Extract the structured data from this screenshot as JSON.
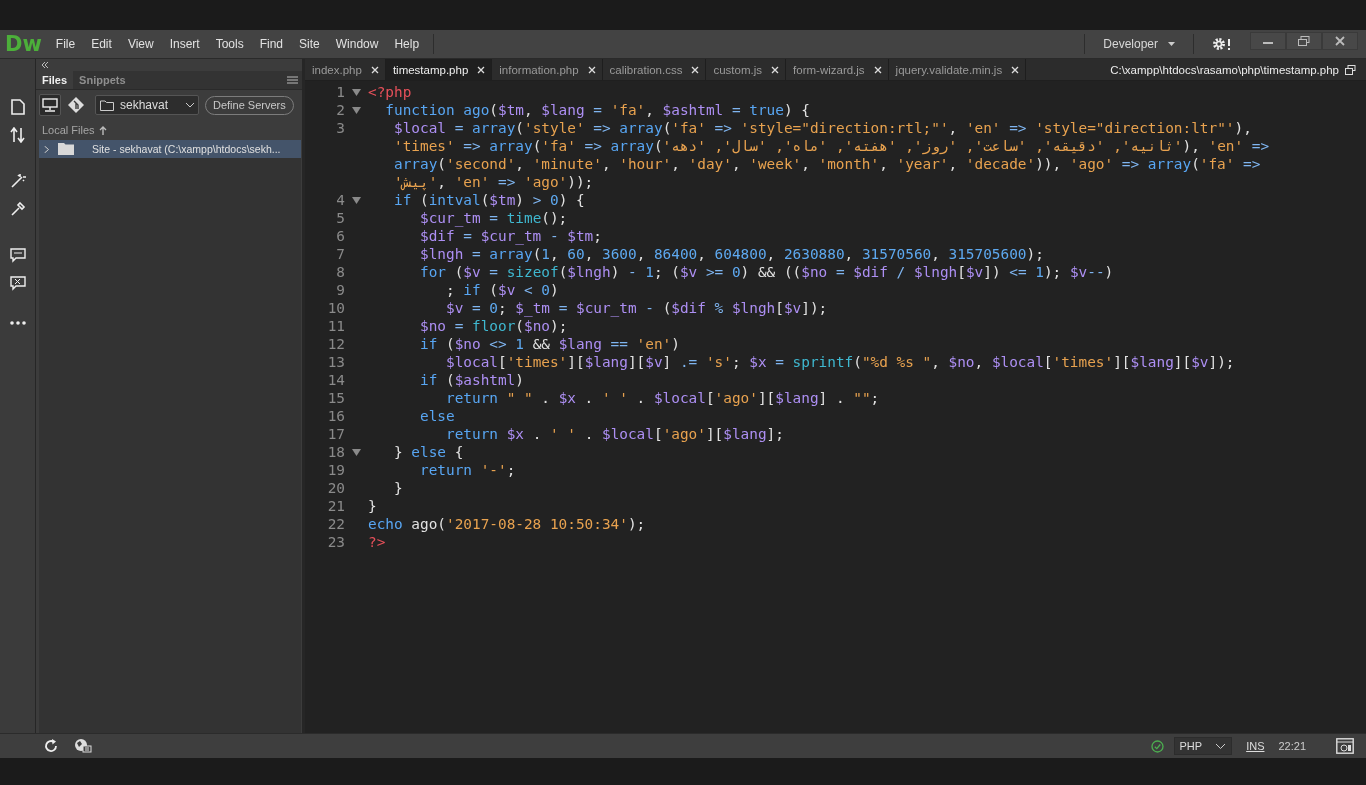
{
  "menu_bar": {
    "logo": "Dw",
    "items": [
      "File",
      "Edit",
      "View",
      "Insert",
      "Tools",
      "Find",
      "Site",
      "Window",
      "Help"
    ],
    "workspace": "Developer"
  },
  "files_panel": {
    "tabs": [
      {
        "label": "Files",
        "selected": true
      },
      {
        "label": "Snippets",
        "selected": false
      }
    ],
    "site": "sekhavat",
    "define_button": "Define Servers",
    "header": "Local Files",
    "tree": [
      {
        "label": "Site - sekhavat (C:\\xampp\\htdocs\\sekh...",
        "selected": true,
        "expanded": false
      }
    ]
  },
  "document_tabs": [
    {
      "label": "index.php",
      "selected": false
    },
    {
      "label": "timestamp.php",
      "selected": true
    },
    {
      "label": "information.php",
      "selected": false
    },
    {
      "label": "calibration.css",
      "selected": false
    },
    {
      "label": "custom.js",
      "selected": false
    },
    {
      "label": "form-wizard.js",
      "selected": false
    },
    {
      "label": "jquery.validate.min.js",
      "selected": false
    }
  ],
  "file_path": "C:\\xampp\\htdocs\\rasamo\\php\\timestamp.php",
  "code": [
    {
      "number": "1",
      "foldable": true,
      "wraps": [
        {
          "tokens": [
            {
              "kind": "tag",
              "text": "<?php"
            }
          ]
        }
      ]
    },
    {
      "number": "2",
      "foldable": true,
      "wraps": [
        {
          "tokens": [
            {
              "kind": "kw",
              "text": "  function"
            },
            {
              "kind": "kw",
              "text": " ago"
            },
            {
              "kind": "text",
              "text": "("
            },
            {
              "kind": "var",
              "text": "$tm"
            },
            {
              "kind": "text",
              "text": ", "
            },
            {
              "kind": "var",
              "text": "$lang"
            },
            {
              "kind": "op",
              "text": " = "
            },
            {
              "kind": "str",
              "text": "'fa'"
            },
            {
              "kind": "text",
              "text": ", "
            },
            {
              "kind": "var",
              "text": "$ashtml"
            },
            {
              "kind": "op",
              "text": " = "
            },
            {
              "kind": "kw",
              "text": "true"
            },
            {
              "kind": "text",
              "text": ") {"
            }
          ]
        }
      ]
    },
    {
      "number": "3",
      "foldable": false,
      "wraps": [
        {
          "tokens": [
            {
              "kind": "var",
              "text": "   $local"
            },
            {
              "kind": "op",
              "text": " = "
            },
            {
              "kind": "kw",
              "text": "array"
            },
            {
              "kind": "text",
              "text": "("
            },
            {
              "kind": "str",
              "text": "'style'"
            },
            {
              "kind": "op",
              "text": " => "
            },
            {
              "kind": "kw",
              "text": "array"
            },
            {
              "kind": "text",
              "text": "("
            },
            {
              "kind": "str",
              "text": "'fa'"
            },
            {
              "kind": "op",
              "text": " => "
            },
            {
              "kind": "str",
              "text": "'style=\"direction:rtl;\"'"
            },
            {
              "kind": "text",
              "text": ", "
            },
            {
              "kind": "str",
              "text": "'en'"
            },
            {
              "kind": "op",
              "text": " => "
            },
            {
              "kind": "str",
              "text": "'style=\"direction:ltr\"'"
            },
            {
              "kind": "text",
              "text": "),"
            }
          ]
        },
        {
          "tokens": [
            {
              "kind": "str",
              "text": "   'times'"
            },
            {
              "kind": "op",
              "text": " => "
            },
            {
              "kind": "kw",
              "text": "array"
            },
            {
              "kind": "text",
              "text": "("
            },
            {
              "kind": "str",
              "text": "'fa'"
            },
            {
              "kind": "op",
              "text": " => "
            },
            {
              "kind": "kw",
              "text": "array"
            },
            {
              "kind": "text",
              "text": "("
            },
            {
              "kind": "str",
              "text": "'ثانیه', 'دقیقه', 'ساعت', 'روز', 'هفته', 'ماه', 'سال', 'دهه'"
            },
            {
              "kind": "text",
              "text": "), "
            },
            {
              "kind": "str",
              "text": "'en'"
            },
            {
              "kind": "op",
              "text": " =>"
            }
          ]
        },
        {
          "tokens": [
            {
              "kind": "kw",
              "text": "   array"
            },
            {
              "kind": "text",
              "text": "("
            },
            {
              "kind": "str",
              "text": "'second'"
            },
            {
              "kind": "text",
              "text": ", "
            },
            {
              "kind": "str",
              "text": "'minute'"
            },
            {
              "kind": "text",
              "text": ", "
            },
            {
              "kind": "str",
              "text": "'hour'"
            },
            {
              "kind": "text",
              "text": ", "
            },
            {
              "kind": "str",
              "text": "'day'"
            },
            {
              "kind": "text",
              "text": ", "
            },
            {
              "kind": "str",
              "text": "'week'"
            },
            {
              "kind": "text",
              "text": ", "
            },
            {
              "kind": "str",
              "text": "'month'"
            },
            {
              "kind": "text",
              "text": ", "
            },
            {
              "kind": "str",
              "text": "'year'"
            },
            {
              "kind": "text",
              "text": ", "
            },
            {
              "kind": "str",
              "text": "'decade'"
            },
            {
              "kind": "text",
              "text": ")), "
            },
            {
              "kind": "str",
              "text": "'ago'"
            },
            {
              "kind": "op",
              "text": " => "
            },
            {
              "kind": "kw",
              "text": "array"
            },
            {
              "kind": "text",
              "text": "("
            },
            {
              "kind": "str",
              "text": "'fa'"
            },
            {
              "kind": "op",
              "text": " =>"
            }
          ]
        },
        {
          "tokens": [
            {
              "kind": "str",
              "text": "   'پیش'"
            },
            {
              "kind": "text",
              "text": ", "
            },
            {
              "kind": "str",
              "text": "'en'"
            },
            {
              "kind": "op",
              "text": " => "
            },
            {
              "kind": "str",
              "text": "'ago'"
            },
            {
              "kind": "text",
              "text": "));"
            }
          ]
        }
      ]
    },
    {
      "number": "4",
      "foldable": true,
      "wraps": [
        {
          "tokens": [
            {
              "kind": "kw",
              "text": "   if"
            },
            {
              "kind": "text",
              "text": " ("
            },
            {
              "kind": "kw",
              "text": "intval"
            },
            {
              "kind": "text",
              "text": "("
            },
            {
              "kind": "var",
              "text": "$tm"
            },
            {
              "kind": "text",
              "text": ") "
            },
            {
              "kind": "op",
              "text": ">"
            },
            {
              "kind": "num",
              "text": " 0"
            },
            {
              "kind": "text",
              "text": ") {"
            }
          ]
        }
      ]
    },
    {
      "number": "5",
      "foldable": false,
      "wraps": [
        {
          "tokens": [
            {
              "kind": "var",
              "text": "      $cur_tm"
            },
            {
              "kind": "op",
              "text": " = "
            },
            {
              "kind": "fn",
              "text": "time"
            },
            {
              "kind": "text",
              "text": "();"
            }
          ]
        }
      ]
    },
    {
      "number": "6",
      "foldable": false,
      "wraps": [
        {
          "tokens": [
            {
              "kind": "var",
              "text": "      $dif"
            },
            {
              "kind": "op",
              "text": " = "
            },
            {
              "kind": "var",
              "text": "$cur_tm"
            },
            {
              "kind": "op",
              "text": " - "
            },
            {
              "kind": "var",
              "text": "$tm"
            },
            {
              "kind": "text",
              "text": ";"
            }
          ]
        }
      ]
    },
    {
      "number": "7",
      "foldable": false,
      "wraps": [
        {
          "tokens": [
            {
              "kind": "var",
              "text": "      $lngh"
            },
            {
              "kind": "op",
              "text": " = "
            },
            {
              "kind": "kw",
              "text": "array"
            },
            {
              "kind": "text",
              "text": "("
            },
            {
              "kind": "num",
              "text": "1"
            },
            {
              "kind": "text",
              "text": ", "
            },
            {
              "kind": "num",
              "text": "60"
            },
            {
              "kind": "text",
              "text": ", "
            },
            {
              "kind": "num",
              "text": "3600"
            },
            {
              "kind": "text",
              "text": ", "
            },
            {
              "kind": "num",
              "text": "86400"
            },
            {
              "kind": "text",
              "text": ", "
            },
            {
              "kind": "num",
              "text": "604800"
            },
            {
              "kind": "text",
              "text": ", "
            },
            {
              "kind": "num",
              "text": "2630880"
            },
            {
              "kind": "text",
              "text": ", "
            },
            {
              "kind": "num",
              "text": "31570560"
            },
            {
              "kind": "text",
              "text": ", "
            },
            {
              "kind": "num",
              "text": "315705600"
            },
            {
              "kind": "text",
              "text": ");"
            }
          ]
        }
      ]
    },
    {
      "number": "8",
      "foldable": false,
      "wraps": [
        {
          "tokens": [
            {
              "kind": "kw",
              "text": "      for"
            },
            {
              "kind": "text",
              "text": " ("
            },
            {
              "kind": "var",
              "text": "$v"
            },
            {
              "kind": "op",
              "text": " = "
            },
            {
              "kind": "fn",
              "text": "sizeof"
            },
            {
              "kind": "text",
              "text": "("
            },
            {
              "kind": "var",
              "text": "$lngh"
            },
            {
              "kind": "text",
              "text": ") "
            },
            {
              "kind": "op",
              "text": "-"
            },
            {
              "kind": "num",
              "text": " 1"
            },
            {
              "kind": "text",
              "text": "; ("
            },
            {
              "kind": "var",
              "text": "$v"
            },
            {
              "kind": "op",
              "text": " >= "
            },
            {
              "kind": "num",
              "text": "0"
            },
            {
              "kind": "text",
              "text": ") && (("
            },
            {
              "kind": "var",
              "text": "$no"
            },
            {
              "kind": "op",
              "text": " = "
            },
            {
              "kind": "var",
              "text": "$dif"
            },
            {
              "kind": "op",
              "text": " / "
            },
            {
              "kind": "var",
              "text": "$lngh"
            },
            {
              "kind": "text",
              "text": "["
            },
            {
              "kind": "var",
              "text": "$v"
            },
            {
              "kind": "text",
              "text": "]) "
            },
            {
              "kind": "op",
              "text": "<="
            },
            {
              "kind": "num",
              "text": " 1"
            },
            {
              "kind": "text",
              "text": "); "
            },
            {
              "kind": "var",
              "text": "$v"
            },
            {
              "kind": "op",
              "text": "--"
            },
            {
              "kind": "text",
              "text": ")"
            }
          ]
        }
      ]
    },
    {
      "number": "9",
      "foldable": false,
      "wraps": [
        {
          "tokens": [
            {
              "kind": "text",
              "text": "         ; "
            },
            {
              "kind": "kw",
              "text": "if"
            },
            {
              "kind": "text",
              "text": " ("
            },
            {
              "kind": "var",
              "text": "$v"
            },
            {
              "kind": "op",
              "text": " < "
            },
            {
              "kind": "num",
              "text": "0"
            },
            {
              "kind": "text",
              "text": ")"
            }
          ]
        }
      ]
    },
    {
      "number": "10",
      "foldable": false,
      "wraps": [
        {
          "tokens": [
            {
              "kind": "var",
              "text": "         $v"
            },
            {
              "kind": "op",
              "text": " = "
            },
            {
              "kind": "num",
              "text": "0"
            },
            {
              "kind": "text",
              "text": "; "
            },
            {
              "kind": "var",
              "text": "$_tm"
            },
            {
              "kind": "op",
              "text": " = "
            },
            {
              "kind": "var",
              "text": "$cur_tm"
            },
            {
              "kind": "op",
              "text": " - "
            },
            {
              "kind": "text",
              "text": "("
            },
            {
              "kind": "var",
              "text": "$dif"
            },
            {
              "kind": "op",
              "text": " % "
            },
            {
              "kind": "var",
              "text": "$lngh"
            },
            {
              "kind": "text",
              "text": "["
            },
            {
              "kind": "var",
              "text": "$v"
            },
            {
              "kind": "text",
              "text": "]);"
            }
          ]
        }
      ]
    },
    {
      "number": "11",
      "foldable": false,
      "wraps": [
        {
          "tokens": [
            {
              "kind": "var",
              "text": "      $no"
            },
            {
              "kind": "op",
              "text": " = "
            },
            {
              "kind": "fn",
              "text": "floor"
            },
            {
              "kind": "text",
              "text": "("
            },
            {
              "kind": "var",
              "text": "$no"
            },
            {
              "kind": "text",
              "text": ");"
            }
          ]
        }
      ]
    },
    {
      "number": "12",
      "foldable": false,
      "wraps": [
        {
          "tokens": [
            {
              "kind": "kw",
              "text": "      if"
            },
            {
              "kind": "text",
              "text": " ("
            },
            {
              "kind": "var",
              "text": "$no"
            },
            {
              "kind": "op",
              "text": " <> "
            },
            {
              "kind": "num",
              "text": "1"
            },
            {
              "kind": "text",
              "text": " && "
            },
            {
              "kind": "var",
              "text": "$lang"
            },
            {
              "kind": "op",
              "text": " == "
            },
            {
              "kind": "str",
              "text": "'en'"
            },
            {
              "kind": "text",
              "text": ")"
            }
          ]
        }
      ]
    },
    {
      "number": "13",
      "foldable": false,
      "wraps": [
        {
          "tokens": [
            {
              "kind": "var",
              "text": "         $local"
            },
            {
              "kind": "text",
              "text": "["
            },
            {
              "kind": "str",
              "text": "'times'"
            },
            {
              "kind": "text",
              "text": "]["
            },
            {
              "kind": "var",
              "text": "$lang"
            },
            {
              "kind": "text",
              "text": "]["
            },
            {
              "kind": "var",
              "text": "$v"
            },
            {
              "kind": "text",
              "text": "] "
            },
            {
              "kind": "op",
              "text": ".="
            },
            {
              "kind": "str",
              "text": " 's'"
            },
            {
              "kind": "text",
              "text": "; "
            },
            {
              "kind": "var",
              "text": "$x"
            },
            {
              "kind": "op",
              "text": " = "
            },
            {
              "kind": "fn",
              "text": "sprintf"
            },
            {
              "kind": "text",
              "text": "("
            },
            {
              "kind": "str",
              "text": "\"%d %s \""
            },
            {
              "kind": "text",
              "text": ", "
            },
            {
              "kind": "var",
              "text": "$no"
            },
            {
              "kind": "text",
              "text": ", "
            },
            {
              "kind": "var",
              "text": "$local"
            },
            {
              "kind": "text",
              "text": "["
            },
            {
              "kind": "str",
              "text": "'times'"
            },
            {
              "kind": "text",
              "text": "]["
            },
            {
              "kind": "var",
              "text": "$lang"
            },
            {
              "kind": "text",
              "text": "]["
            },
            {
              "kind": "var",
              "text": "$v"
            },
            {
              "kind": "text",
              "text": "]);"
            }
          ]
        }
      ]
    },
    {
      "number": "14",
      "foldable": false,
      "wraps": [
        {
          "tokens": [
            {
              "kind": "kw",
              "text": "      if"
            },
            {
              "kind": "text",
              "text": " ("
            },
            {
              "kind": "var",
              "text": "$ashtml"
            },
            {
              "kind": "text",
              "text": ")"
            }
          ]
        }
      ]
    },
    {
      "number": "15",
      "foldable": false,
      "wraps": [
        {
          "tokens": [
            {
              "kind": "kw",
              "text": "         return"
            },
            {
              "kind": "str",
              "text": " \" \""
            },
            {
              "kind": "text",
              "text": " . "
            },
            {
              "kind": "var",
              "text": "$x"
            },
            {
              "kind": "text",
              "text": " . "
            },
            {
              "kind": "str",
              "text": "' '"
            },
            {
              "kind": "text",
              "text": " . "
            },
            {
              "kind": "var",
              "text": "$local"
            },
            {
              "kind": "text",
              "text": "["
            },
            {
              "kind": "str",
              "text": "'ago'"
            },
            {
              "kind": "text",
              "text": "]["
            },
            {
              "kind": "var",
              "text": "$lang"
            },
            {
              "kind": "text",
              "text": "] . "
            },
            {
              "kind": "str",
              "text": "\"\""
            },
            {
              "kind": "text",
              "text": ";"
            }
          ]
        }
      ]
    },
    {
      "number": "16",
      "foldable": false,
      "wraps": [
        {
          "tokens": [
            {
              "kind": "kw",
              "text": "      else"
            }
          ]
        }
      ]
    },
    {
      "number": "17",
      "foldable": false,
      "wraps": [
        {
          "tokens": [
            {
              "kind": "kw",
              "text": "         return"
            },
            {
              "kind": "var",
              "text": " $x"
            },
            {
              "kind": "text",
              "text": " . "
            },
            {
              "kind": "str",
              "text": "' '"
            },
            {
              "kind": "text",
              "text": " . "
            },
            {
              "kind": "var",
              "text": "$local"
            },
            {
              "kind": "text",
              "text": "["
            },
            {
              "kind": "str",
              "text": "'ago'"
            },
            {
              "kind": "text",
              "text": "]["
            },
            {
              "kind": "var",
              "text": "$lang"
            },
            {
              "kind": "text",
              "text": "];"
            }
          ]
        }
      ]
    },
    {
      "number": "18",
      "foldable": true,
      "wraps": [
        {
          "tokens": [
            {
              "kind": "text",
              "text": "   } "
            },
            {
              "kind": "kw",
              "text": "else"
            },
            {
              "kind": "text",
              "text": " {"
            }
          ]
        }
      ]
    },
    {
      "number": "19",
      "foldable": false,
      "wraps": [
        {
          "tokens": [
            {
              "kind": "kw",
              "text": "      return"
            },
            {
              "kind": "str",
              "text": " '-'"
            },
            {
              "kind": "text",
              "text": ";"
            }
          ]
        }
      ]
    },
    {
      "number": "20",
      "foldable": false,
      "wraps": [
        {
          "tokens": [
            {
              "kind": "text",
              "text": "   }"
            }
          ]
        }
      ]
    },
    {
      "number": "21",
      "foldable": false,
      "wraps": [
        {
          "tokens": [
            {
              "kind": "text",
              "text": "}"
            }
          ]
        }
      ]
    },
    {
      "number": "22",
      "foldable": false,
      "wraps": [
        {
          "tokens": [
            {
              "kind": "kw",
              "text": "echo"
            },
            {
              "kind": "text",
              "text": " ago("
            },
            {
              "kind": "str",
              "text": "'2017-08-28 10:50:34'"
            },
            {
              "kind": "text",
              "text": ");"
            }
          ]
        }
      ]
    },
    {
      "number": "23",
      "foldable": false,
      "wraps": [
        {
          "tokens": [
            {
              "kind": "tag",
              "text": "?>"
            }
          ]
        }
      ]
    }
  ],
  "status_bar": {
    "language": "PHP",
    "mode": "INS",
    "position": "22:21"
  }
}
